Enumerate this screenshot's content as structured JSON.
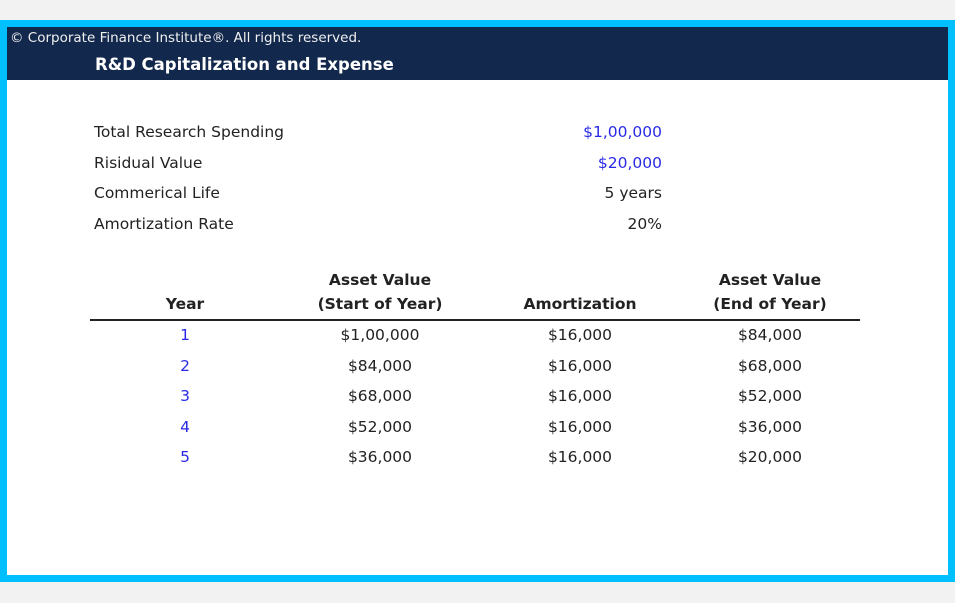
{
  "banner": {
    "copyright": "© Corporate Finance Institute®. All rights reserved.",
    "title": "R&D Capitalization and Expense"
  },
  "inputs": [
    {
      "label": "Total Research Spending",
      "value": "$1,00,000",
      "is_input": true
    },
    {
      "label": "Risidual Value",
      "value": "$20,000",
      "is_input": true
    },
    {
      "label": "Commerical Life",
      "value": "5 years",
      "is_input": false
    },
    {
      "label": "Amortization Rate",
      "value": "20%",
      "is_input": false
    }
  ],
  "table": {
    "headers": [
      {
        "line1": "",
        "line2": "Year"
      },
      {
        "line1": "Asset Value",
        "line2": "(Start of Year)"
      },
      {
        "line1": "",
        "line2": "Amortization"
      },
      {
        "line1": "Asset Value",
        "line2": "(End of Year)"
      }
    ],
    "rows": [
      [
        "1",
        "$1,00,000",
        "$16,000",
        "$84,000"
      ],
      [
        "2",
        "$84,000",
        "$16,000",
        "$68,000"
      ],
      [
        "3",
        "$68,000",
        "$16,000",
        "$52,000"
      ],
      [
        "4",
        "$52,000",
        "$16,000",
        "$36,000"
      ],
      [
        "5",
        "$36,000",
        "$16,000",
        "$20,000"
      ]
    ]
  },
  "colors": {
    "frame": "#00bfff",
    "banner": "#12284c",
    "input_blue": "#2a2ae6"
  }
}
